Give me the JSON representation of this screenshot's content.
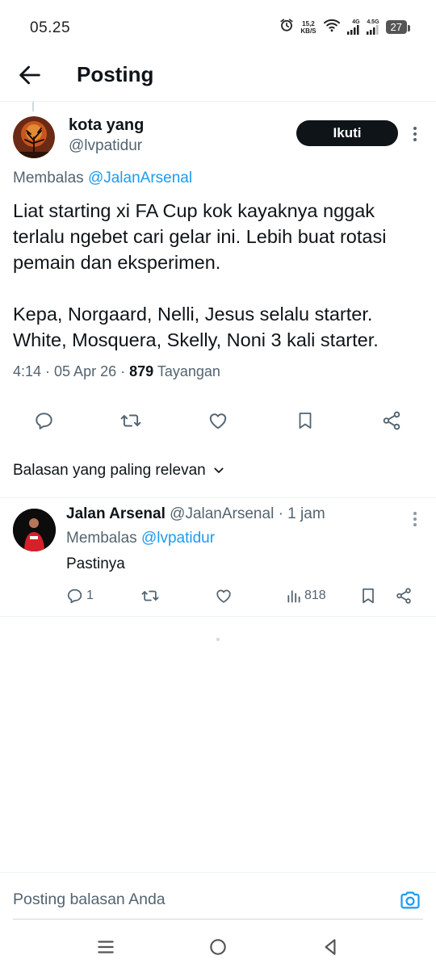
{
  "status_bar": {
    "time": "05.25",
    "net_speed_value": "15,2",
    "net_speed_unit": "KB/S",
    "signal1_label": "4G",
    "signal2_label": "4.5G",
    "battery": "27",
    "icons": [
      "alarm-icon",
      "wifi-icon",
      "signal-icon",
      "signal-icon",
      "battery-icon"
    ]
  },
  "header": {
    "title": "Posting",
    "back_icon": "arrow-left-icon"
  },
  "post": {
    "author_name": "kota yang",
    "author_handle": "@lvpatidur",
    "follow_label": "Ikuti",
    "replying_prefix": "Membalas",
    "replying_mention": "@JalanArsenal",
    "text_lines": [
      "Liat starting xi FA Cup kok kayaknya nggak",
      "terlalu ngebet cari gelar ini. Lebih buat rotasi",
      "pemain dan eksperimen.",
      "",
      "Kepa, Norgaard, Nelli, Jesus selalu starter.",
      "White, Mosquera, Skelly, Noni 3 kali starter."
    ],
    "timestamp": "4:14 · 05 Apr 26 · ",
    "views_count": "879",
    "views_label": "Tayangan",
    "action_icons": [
      "reply-icon",
      "retweet-icon",
      "like-icon",
      "bookmark-icon",
      "share-icon"
    ]
  },
  "sort": {
    "label": "Balasan yang paling relevan"
  },
  "reply": {
    "author_name": "Jalan Arsenal",
    "author_handle": "@JalanArsenal",
    "time_ago": "· 1 jam",
    "replying_prefix": "Membalas",
    "replying_mention": "@lvpatidur",
    "text": "Pastinya",
    "reply_count": "1",
    "views_count": "818"
  },
  "compose": {
    "placeholder": "Posting balasan Anda"
  },
  "colors": {
    "accent": "#1d9bf0",
    "text_primary": "#0f1419",
    "text_secondary": "#536471",
    "follow_bg": "#0f1419"
  }
}
